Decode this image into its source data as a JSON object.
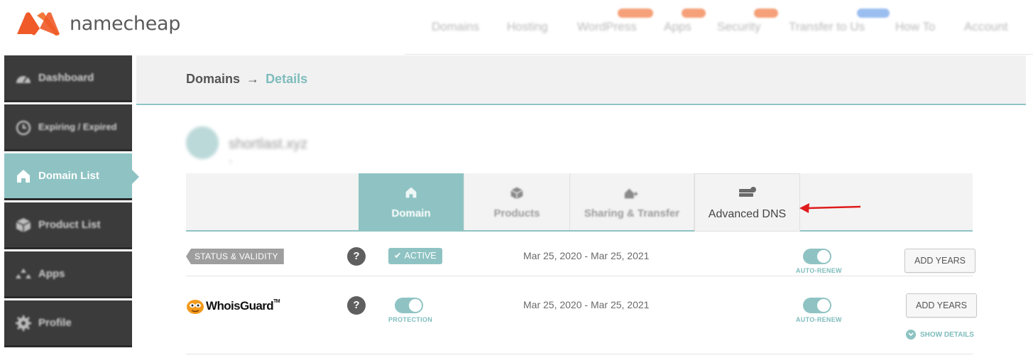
{
  "brand": {
    "name": "namecheap",
    "logo_color": "#f05a28"
  },
  "topnav": [
    {
      "label": "Domains"
    },
    {
      "label": "Hosting"
    },
    {
      "label": "WordPress"
    },
    {
      "label": "Apps"
    },
    {
      "label": "Security"
    },
    {
      "label": "Transfer to Us"
    },
    {
      "label": "How To"
    },
    {
      "label": "Account"
    }
  ],
  "sidebar": {
    "items": [
      {
        "label": "Dashboard",
        "icon": "dashboard-icon"
      },
      {
        "label": "Expiring / Expired",
        "icon": "clock-icon"
      },
      {
        "label": "Domain List",
        "icon": "home-icon",
        "active": true
      },
      {
        "label": "Product List",
        "icon": "box-icon"
      },
      {
        "label": "Apps",
        "icon": "apps-icon"
      },
      {
        "label": "Profile",
        "icon": "gear-icon"
      }
    ]
  },
  "breadcrumb": {
    "root": "Domains",
    "separator": "→",
    "current": "Details"
  },
  "domain": {
    "name": "shortlast.xyz",
    "sub": "↑"
  },
  "tabs": [
    {
      "label": "Domain",
      "icon": "home-icon",
      "active": true
    },
    {
      "label": "Products",
      "icon": "box-icon"
    },
    {
      "label": "Sharing & Transfer",
      "icon": "share-icon"
    },
    {
      "label": "Advanced DNS",
      "icon": "server-icon"
    }
  ],
  "rows": {
    "status": {
      "tag": "STATUS & VALIDITY",
      "help": "?",
      "badge": "ACTIVE",
      "dates": "Mar 25, 2020 - Mar 25, 2021",
      "toggle_label": "AUTO-RENEW",
      "button": "ADD YEARS"
    },
    "whoisguard": {
      "brand": "WhoisGuard",
      "tm": "TM",
      "help": "?",
      "protection_label": "PROTECTION",
      "dates": "Mar 25, 2020 - Mar 25, 2021",
      "toggle_label": "AUTO-RENEW",
      "button": "ADD YEARS",
      "show_details": "SHOW DETAILS"
    }
  },
  "colors": {
    "accent": "#8fc3c3",
    "sidebar": "#3b3b3b",
    "annotation_arrow": "#e01b1b"
  }
}
